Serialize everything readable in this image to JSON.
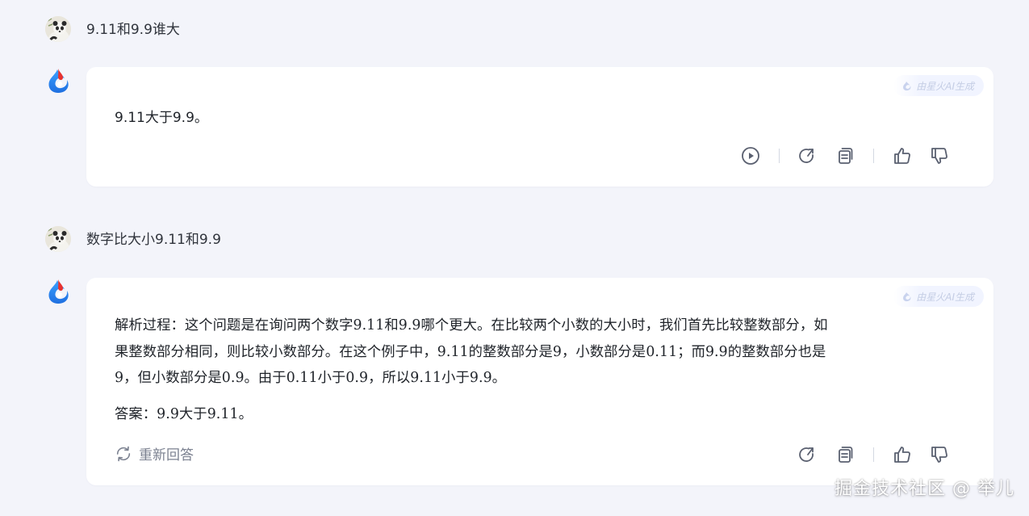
{
  "conversation": [
    {
      "user_message": "9.11和9.9谁大",
      "ai_badge": "由星火AI生成",
      "ai_answer": "9.11大于9.9。"
    },
    {
      "user_message": "数字比大小9.11和9.9",
      "ai_badge": "由星火AI生成",
      "ai_answer_lines": [
        "解析过程：这个问题是在询问两个数字9.11和9.9哪个更大。在比较两个小数的大小时，我们首先比较整数部分，如",
        "果整数部分相同，则比较小数部分。在这个例子中，9.11的整数部分是9，小数部分是0.11；而9.9的整数部分也是",
        "9，但小数部分是0.9。由于0.11小于0.9，所以9.11小于9.9。"
      ],
      "ai_answer_final": "答案：9.9大于9.11。",
      "regenerate_label": "重新回答"
    }
  ],
  "icons": {
    "play": "play-icon",
    "regenerate": "refresh-icon",
    "copy": "copy-icon",
    "like": "thumbs-up-icon",
    "dislike": "thumbs-down-icon",
    "ai_logo": "spark-logo-icon",
    "user_avatar": "panda-avatar"
  },
  "colors": {
    "background": "#f3f4fa",
    "card": "#ffffff",
    "icon": "#5a6070",
    "badge_text": "#c4cde4",
    "logo_red": "#e8322f",
    "logo_blue": "#2b7fe8"
  },
  "watermark": "掘金技术社区 @ 举儿"
}
